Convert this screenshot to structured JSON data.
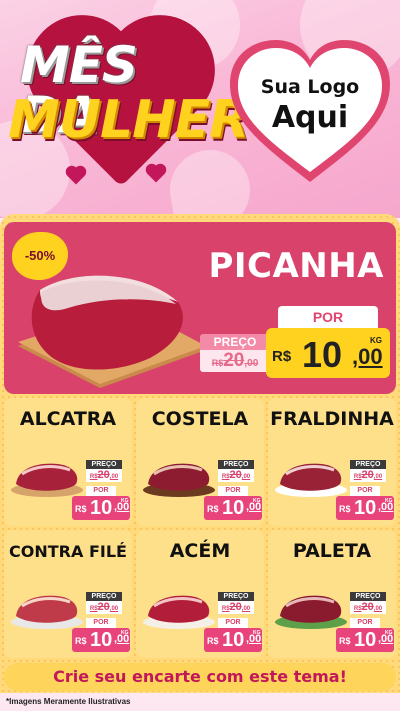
{
  "header": {
    "title_line1": "MÊS DA",
    "title_line2": "MULHER",
    "logo_line1": "Sua Logo",
    "logo_line2": "Aqui"
  },
  "featured": {
    "name": "PICANHA",
    "discount": "-50%",
    "old_price_label": "PREÇO",
    "old_currency": "R$",
    "old_price": "20",
    "old_cents": ",00",
    "new_price_label": "POR",
    "currency": "R$",
    "price": "10",
    "cents": ",00",
    "unit": "KG"
  },
  "products": [
    {
      "name": "ALCATRA",
      "old_label": "PREÇO",
      "old_currency": "R$",
      "old_price": "20",
      "old_cents": ",00",
      "new_label": "POR",
      "currency": "R$",
      "price": "10",
      "cents": ",00",
      "unit": "KG"
    },
    {
      "name": "COSTELA",
      "old_label": "PREÇO",
      "old_currency": "R$",
      "old_price": "20",
      "old_cents": ",00",
      "new_label": "POR",
      "currency": "R$",
      "price": "10",
      "cents": ",00",
      "unit": "KG"
    },
    {
      "name": "FRALDINHA",
      "old_label": "PREÇO",
      "old_currency": "R$",
      "old_price": "20",
      "old_cents": ",00",
      "new_label": "POR",
      "currency": "R$",
      "price": "10",
      "cents": ",00",
      "unit": "KG"
    },
    {
      "name": "CONTRA FILÉ",
      "old_label": "PREÇO",
      "old_currency": "R$",
      "old_price": "20",
      "old_cents": ",00",
      "new_label": "POR",
      "currency": "R$",
      "price": "10",
      "cents": ",00",
      "unit": "KG"
    },
    {
      "name": "ACÉM",
      "old_label": "PREÇO",
      "old_currency": "R$",
      "old_price": "20",
      "old_cents": ",00",
      "new_label": "POR",
      "currency": "R$",
      "price": "10",
      "cents": ",00",
      "unit": "KG"
    },
    {
      "name": "PALETA",
      "old_label": "PREÇO",
      "old_currency": "R$",
      "old_price": "20",
      "old_cents": ",00",
      "new_label": "POR",
      "currency": "R$",
      "price": "10",
      "cents": ",00",
      "unit": "KG"
    }
  ],
  "footer": {
    "cta": "Crie seu encarte com este tema!",
    "note": "*Imagens Meramente Ilustrativas"
  },
  "colors": {
    "pink": "#d9436b",
    "yellow": "#ffd21f",
    "panel": "#ffd97a",
    "price_pink": "#e8437a"
  }
}
